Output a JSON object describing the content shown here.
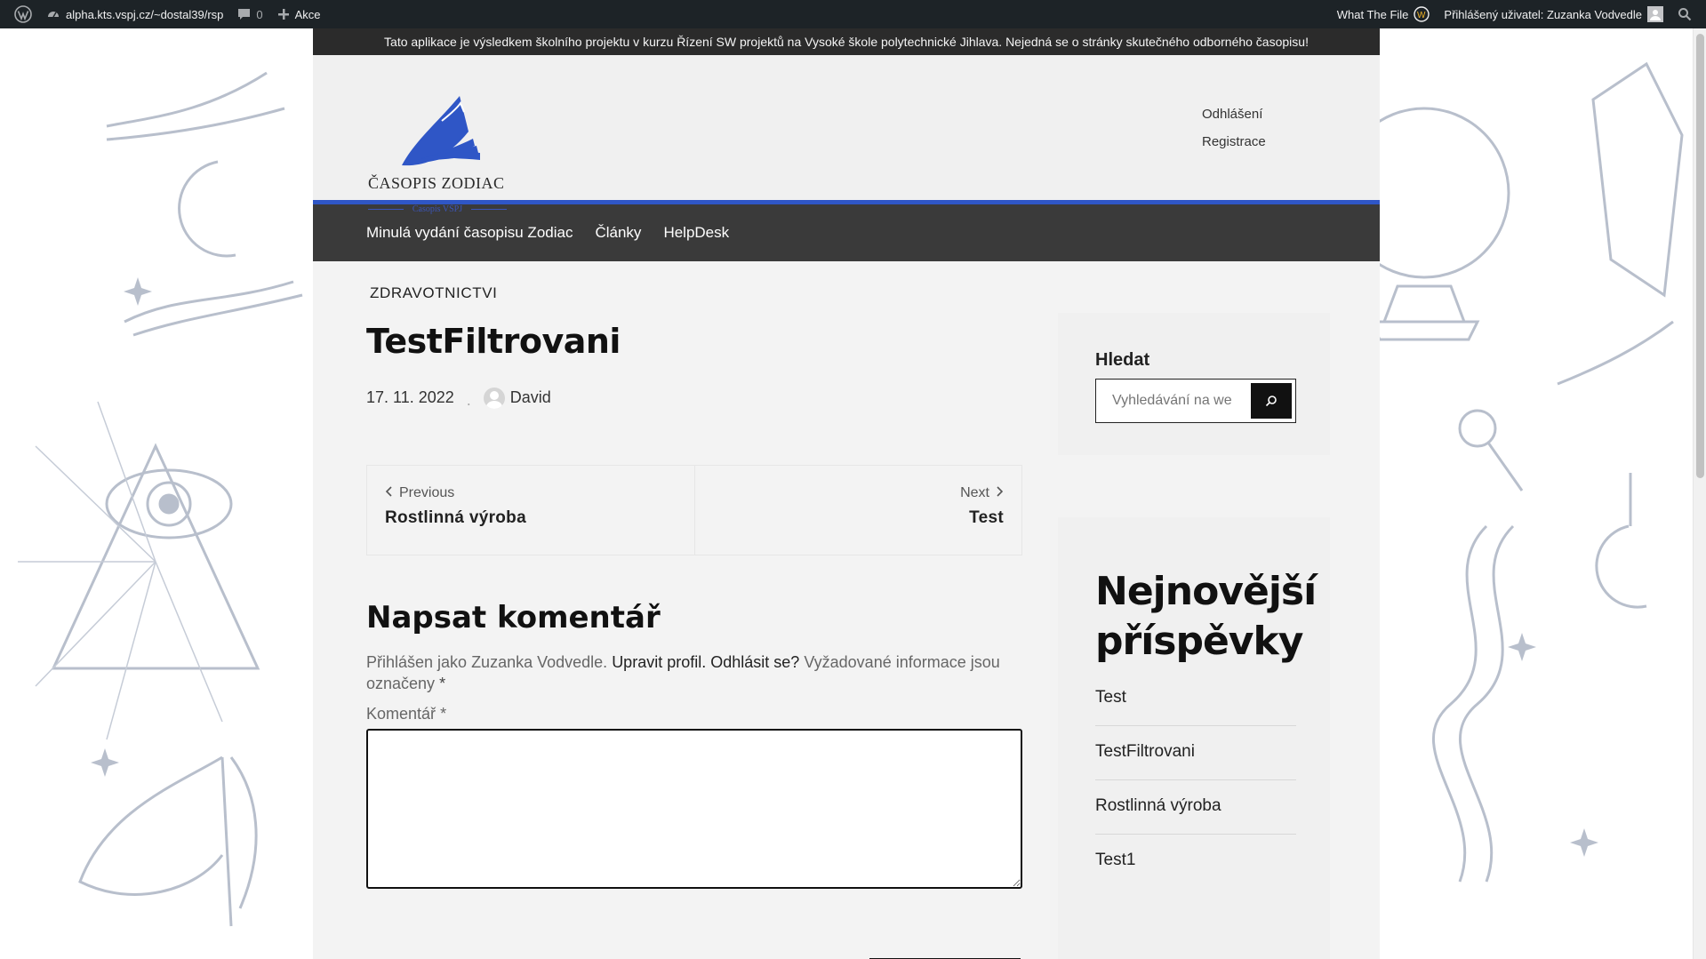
{
  "adminbar": {
    "site_url": "alpha.kts.vspj.cz/~dostal39/rsp",
    "comments_count": "0",
    "new_label": "Akce",
    "plugin_label": "What The File",
    "user_label": "Přihlášený uživatel: Zuzanka Vodvedle"
  },
  "notice": "Tato aplikace je výsledkem školního projektu v kurzu Řízení SW projektů na Vysoké škole polytechnické Jihlava. Nejedná se o stránky skutečného odborného časopisu!",
  "header": {
    "logo_title": "ČASOPIS ZODIAC",
    "logo_subtitle": "Časopis VŠPJ",
    "links": [
      "Odhlášení",
      "Registrace"
    ],
    "accent_color": "#2f56c6"
  },
  "nav": {
    "items": [
      "Minulá vydání časopisu Zodiac",
      "Články",
      "HelpDesk"
    ]
  },
  "post": {
    "category": "ZDRAVOTNICTVI",
    "title": "TestFiltrovani",
    "date": "17. 11. 2022",
    "author": "David"
  },
  "postnav": {
    "prev_label": "Previous",
    "prev_title": "Rostlinná výroba",
    "next_label": "Next",
    "next_title": "Test"
  },
  "comment": {
    "title": "Napsat komentář",
    "logged_prefix": "Přihlášen jako Zuzanka Vodvedle.",
    "edit_profile": "Upravit profil.",
    "logout": "Odhlásit se?",
    "required_note": "Vyžadované informace jsou označeny",
    "asterisk": "*",
    "field_label": "Komentář",
    "field_value": ""
  },
  "sidebar": {
    "search_title": "Hledat",
    "search_placeholder": "Vyhledávání na webu...",
    "recent_title": "Nejnovější příspěvky",
    "recent_items": [
      "Test",
      "TestFiltrovani",
      "Rostlinná výroba",
      "Test1"
    ]
  },
  "icons": {
    "wordpress": "wordpress-icon",
    "dashboard": "dashboard-icon",
    "comment": "comment-icon",
    "plus": "plus-icon",
    "search": "search-icon"
  }
}
